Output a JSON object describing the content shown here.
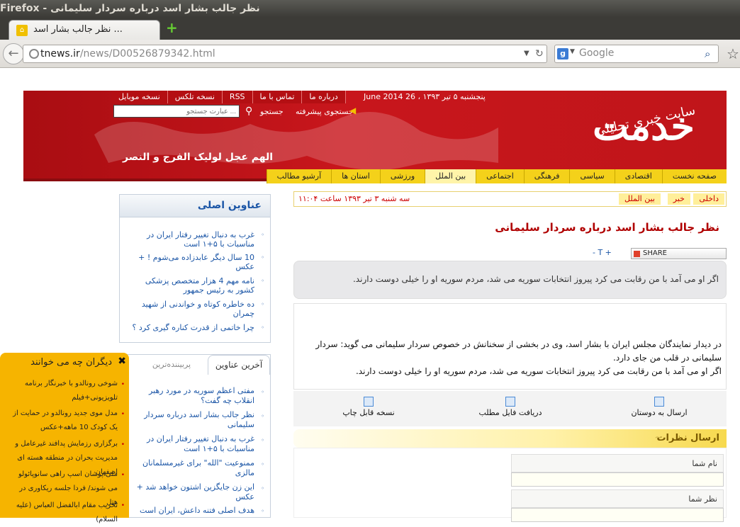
{
  "browser": {
    "window_title": "Firefox - نظر جالب بشار اسد درباره سردار سلیمانی",
    "tab_title": "نظر جالب بشار اسد ...",
    "url_host": "tnews.ir",
    "url_path": "/news/D00526879342.html",
    "search_placeholder": "Google",
    "search_engine": "g"
  },
  "banner": {
    "top_links": [
      "درباره ما",
      "تماس با ما",
      "RSS",
      "نسخه تلکس",
      "نسخه موبایل"
    ],
    "date": "پنجشنبه ۵ تیر ۱۳۹۳ ، 26 June 2014",
    "search_placeholder": "عبارت جستجو ...",
    "search_label": "جستجو",
    "advanced_search": "جستجوی پیشرفته",
    "prayer": "الهم عجل لولیک الفرج و النصر",
    "logo_main": "خدمت",
    "logo_sub": "سایت خبری تحلیلی"
  },
  "nav": {
    "items": [
      "صفحه نخست",
      "اقتصادی",
      "سیاسی",
      "فرهنگی",
      "اجتماعی",
      "بین الملل",
      "ورزشی",
      "استان ها",
      "آرشیو مطالب"
    ],
    "active": "بین الملل"
  },
  "article": {
    "breadcrumb": [
      "داخلی",
      "خبر",
      "بین الملل"
    ],
    "published": "سه شنبه ۳ تیر ۱۳۹۳ ساعت ۱۱:۰۴",
    "title": "نظر جالب بشار اسد درباره سردار سلیمانی",
    "font_controls": "- T +",
    "share_label": "SHARE",
    "lead": "اگر او می آمد با من رقابت می کرد پیروز انتخابات سوریه می شد، مردم سوریه او را خیلی دوست دارند.",
    "body_1": "در دیدار نمایندگان مجلس ایران با بشار اسد، وی در بخشی از سخنانش در خصوص سردار سلیمانی می گوید: سردار سلیمانی در قلب من جای دارد.",
    "body_2": "اگر او می آمد با من رقابت می کرد پیروز انتخابات سوریه می شد، مردم سوریه او را خیلی دوست دارند.",
    "tools": [
      "ارسال به دوستان",
      "دریافت فایل مطلب",
      "نسخه قابل چاپ"
    ],
    "comment_title": "ارسال نظرات",
    "field_name": "نام شما",
    "field_comment": "نظر شما"
  },
  "main_headlines": {
    "title": "عناوین اصلی",
    "items": [
      "غرب به دنبال تغییر رفتار ایران در مناسبات با ۵+۱ است",
      "10 سال دیگر عابدزاده می‌شوم ! + عکس",
      "نامه مهم 4 هزار متخصص پزشکی کشور به رئیس جمهور",
      "ده خاطره کوتاه و خواندنی از شهید چمران",
      "چرا خاتمی از قدرت کناره گیری کرد ؟"
    ]
  },
  "latest": {
    "tab_latest": "آخرین عناوین",
    "tab_popular": "پربیننده‌ترین",
    "items": [
      "مفتی اعظم سوریه در مورد رهبر انقلاب چه گفت؟",
      "نظر جالب بشار اسد درباره سردار سلیمانی",
      "غرب به دنبال تغییر رفتار ایران در مناسبات با ۵+۱ است",
      "ممنوعیت \"الله\" برای غیرمسلمانان مالزی",
      "این زن جایگزین اشتون خواهد شد + عکس",
      "هدف اصلی فتنه داعش، ایران است"
    ]
  },
  "popup": {
    "title": "دیگران چه می خوانند",
    "items": [
      "شوخی رونالدو با خبرنگار برنامه تلویزیونی+فیلم",
      "مدل موی جدید رونالدو در حمایت از یک کودک 10 ماهه+عکس",
      "برگزاری رزمایش پدافند غیرعامل و مدیریت بحران در منطقه هسته ای اصفهان",
      "ملی پوشان اسپ راهی سانوپائولو می شوند/ فردا جلسه ریکاوری در هتل",
      "تخریب مقام ابالفضل العباس (علیه السلام)"
    ]
  },
  "colors": {
    "banner_red": "#c0151a",
    "nav_yellow": "#f4d11a",
    "link_blue": "#1a55a6",
    "popup_orange": "#f6b400"
  }
}
